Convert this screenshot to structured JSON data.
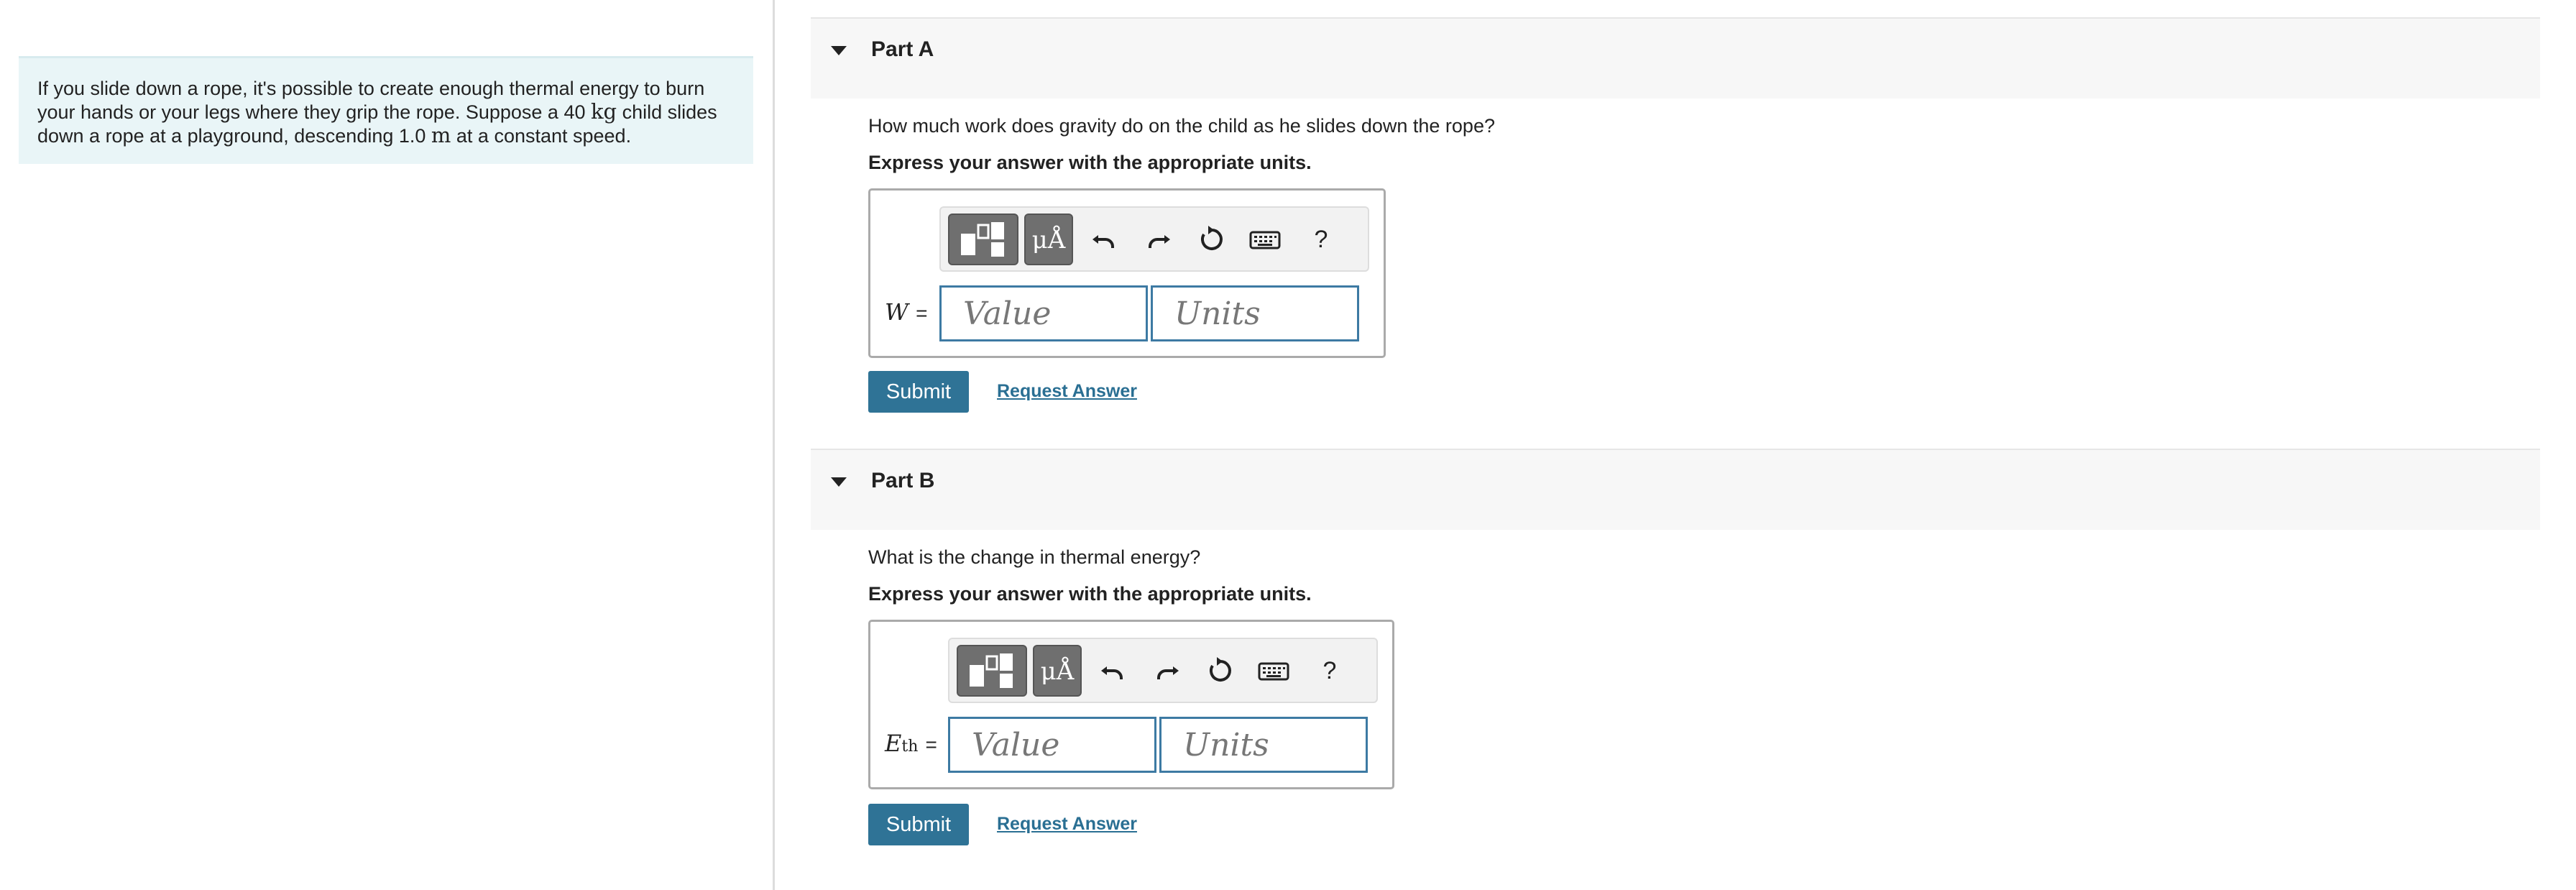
{
  "problem": {
    "text_1": "If you slide down a rope, it's possible to create enough thermal energy to burn your hands or your legs where they grip the rope. Suppose a 40 ",
    "mass_unit": "kg",
    "text_2": " child slides down a rope at a playground, descending 1.0 ",
    "distance_unit": "m",
    "text_3": " at a constant speed."
  },
  "toolbar": {
    "templates_icon": "templates-icon",
    "units_label": "μÅ",
    "undo_icon": "undo-icon",
    "redo_icon": "redo-icon",
    "reset_icon": "reset-icon",
    "keyboard_icon": "keyboard-icon",
    "help_label": "?"
  },
  "parts": {
    "a": {
      "title": "Part A",
      "question": "How much work does gravity do on the child as he slides down the rope?",
      "instruction": "Express your answer with the appropriate units.",
      "var_symbol": "W",
      "equals": "=",
      "value_placeholder": "Value",
      "units_placeholder": "Units",
      "submit_label": "Submit",
      "request_label": "Request Answer"
    },
    "b": {
      "title": "Part B",
      "question": "What is the change in thermal energy?",
      "instruction": "Express your answer with the appropriate units.",
      "var_symbol": "E",
      "var_subscript": "th",
      "equals": "=",
      "value_placeholder": "Value",
      "units_placeholder": "Units",
      "submit_label": "Submit",
      "request_label": "Request Answer"
    }
  },
  "colors": {
    "problem_bg": "#e9f5f7",
    "input_border": "#3d7aa3",
    "submit_bg": "#2f7396",
    "link": "#2a6f93"
  }
}
